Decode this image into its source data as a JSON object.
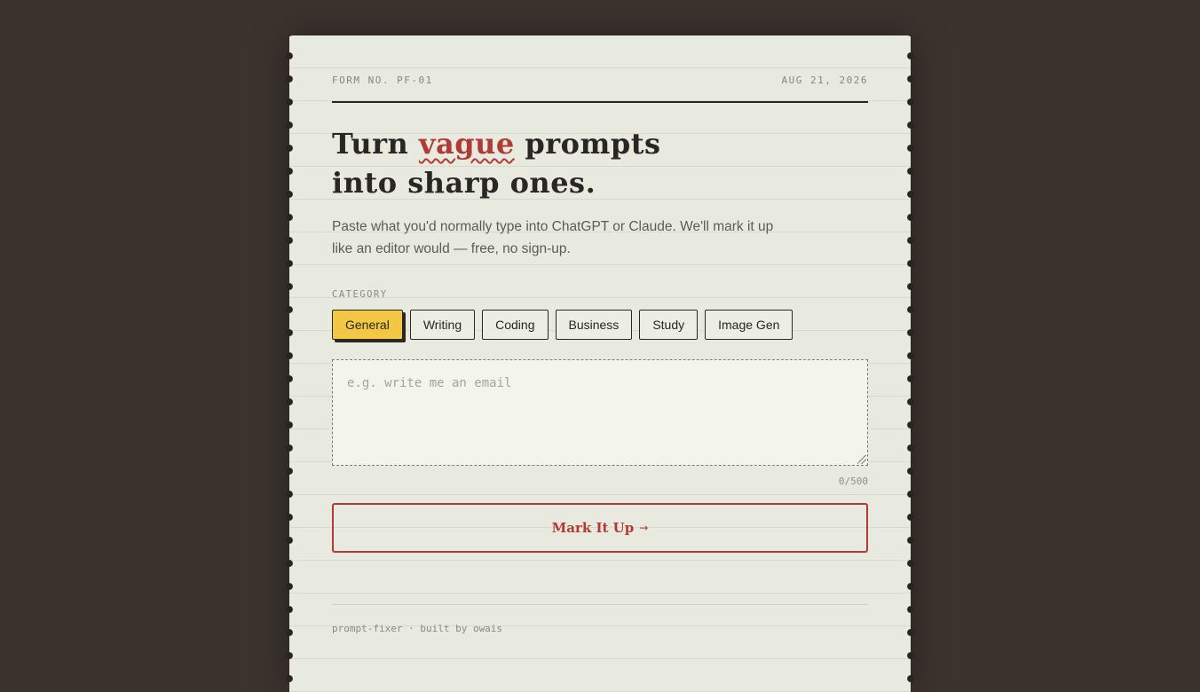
{
  "form": {
    "number": "FORM NO. PF-01",
    "date": "AUG 21, 2026"
  },
  "headline": {
    "part1": "Turn ",
    "highlight": "vague",
    "part2": " prompts",
    "line2": "into sharp ones."
  },
  "subtitle": "Paste what you'd normally type into ChatGPT or Claude. We'll mark it up like an editor would — free, no sign-up.",
  "category": {
    "label": "CATEGORY",
    "selected": "General",
    "options": [
      "General",
      "Writing",
      "Coding",
      "Business",
      "Study",
      "Image Gen"
    ]
  },
  "prompt": {
    "placeholder": "e.g. write me an email",
    "value": "",
    "char_count": "0/500"
  },
  "submit": {
    "label": "Mark It Up",
    "arrow": "→"
  },
  "footer": {
    "text": "prompt-fixer · built by owais"
  },
  "colors": {
    "background": "#3b332e",
    "paper": "#e9eadf",
    "accent_red": "#b03a35",
    "chip_active": "#f2c744",
    "ink": "#2a2623"
  }
}
